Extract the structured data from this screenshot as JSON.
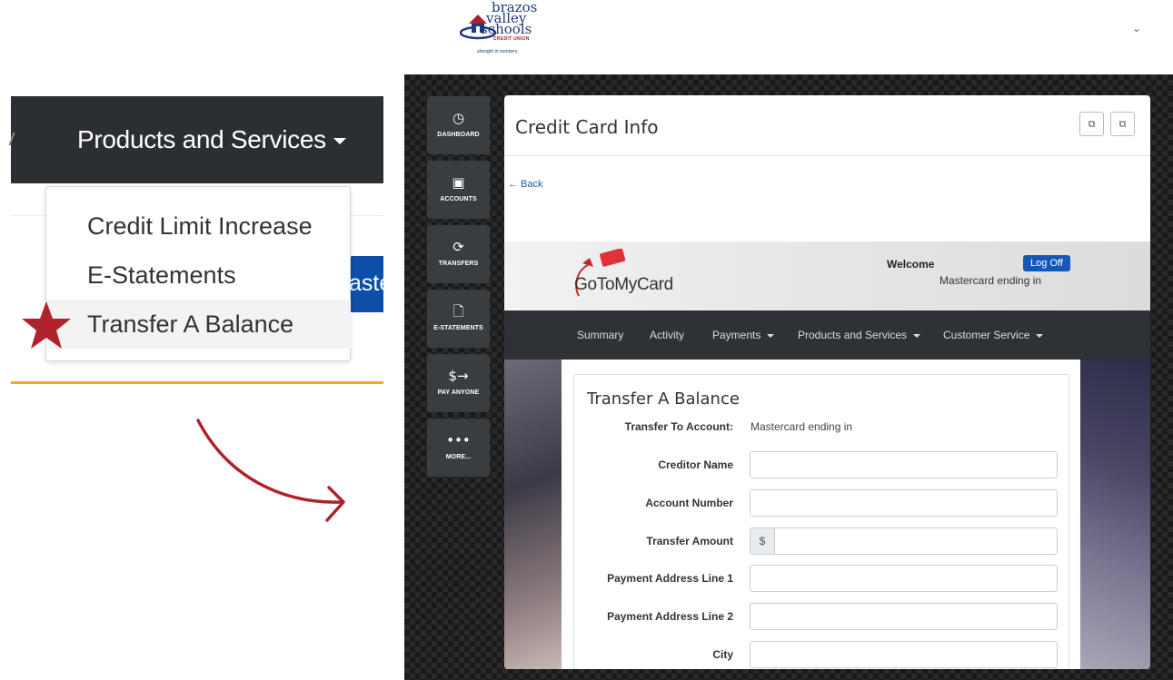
{
  "logo": {
    "line1": "brazos",
    "line2": "valley",
    "line3": "schools",
    "line4": "CREDIT UNION",
    "tagline": "strength in numbers."
  },
  "top_chevron": "⌄",
  "zoom": {
    "menu_label": "Products and Services",
    "partial_button": "aste",
    "items": [
      {
        "label": "Credit Limit Increase"
      },
      {
        "label": "E-Statements"
      },
      {
        "label": "Transfer A Balance"
      }
    ],
    "highlighted_item": "Transfer A Balance",
    "accent_color": "#f5a623",
    "star_color": "#b0222b"
  },
  "sidebar": {
    "items": [
      {
        "icon": "dashboard-icon",
        "glyph": "◷",
        "label": "DASHBOARD"
      },
      {
        "icon": "wallet-icon",
        "glyph": "▣",
        "label": "ACCOUNTS"
      },
      {
        "icon": "transfer-icon",
        "glyph": "⟳",
        "label": "TRANSFERS"
      },
      {
        "icon": "document-icon",
        "glyph": "🗋",
        "label": "E-STATEMENTS"
      },
      {
        "icon": "pay-icon",
        "glyph": "$→",
        "label": "PAY ANYONE"
      },
      {
        "icon": "more-icon",
        "glyph": "•••",
        "label": "MORE..."
      }
    ]
  },
  "panel": {
    "title": "Credit Card Info",
    "back_label": "← Back",
    "header_buttons": [
      "⧉",
      "⧉"
    ]
  },
  "gotomycard": {
    "brand": "GoToMyCard",
    "welcome": "Welcome",
    "logoff": "Log Off",
    "card_text": "Mastercard ending in",
    "nav": [
      {
        "label": "Summary",
        "dropdown": false
      },
      {
        "label": "Activity",
        "dropdown": false
      },
      {
        "label": "Payments",
        "dropdown": true
      },
      {
        "label": "Products and Services",
        "dropdown": true
      },
      {
        "label": "Customer Service",
        "dropdown": true
      }
    ],
    "nav_color": "#2e3236",
    "logoff_color": "#1559b8"
  },
  "form": {
    "title": "Transfer A Balance",
    "transfer_to_label": "Transfer To Account:",
    "transfer_to_value": "Mastercard ending in",
    "fields": [
      {
        "label": "Creditor Name",
        "value": ""
      },
      {
        "label": "Account Number",
        "value": ""
      },
      {
        "label": "Transfer Amount",
        "prefix": "$",
        "value": ""
      },
      {
        "label": "Payment Address Line 1",
        "value": ""
      },
      {
        "label": "Payment Address Line 2",
        "value": ""
      },
      {
        "label": "City",
        "value": ""
      }
    ]
  }
}
